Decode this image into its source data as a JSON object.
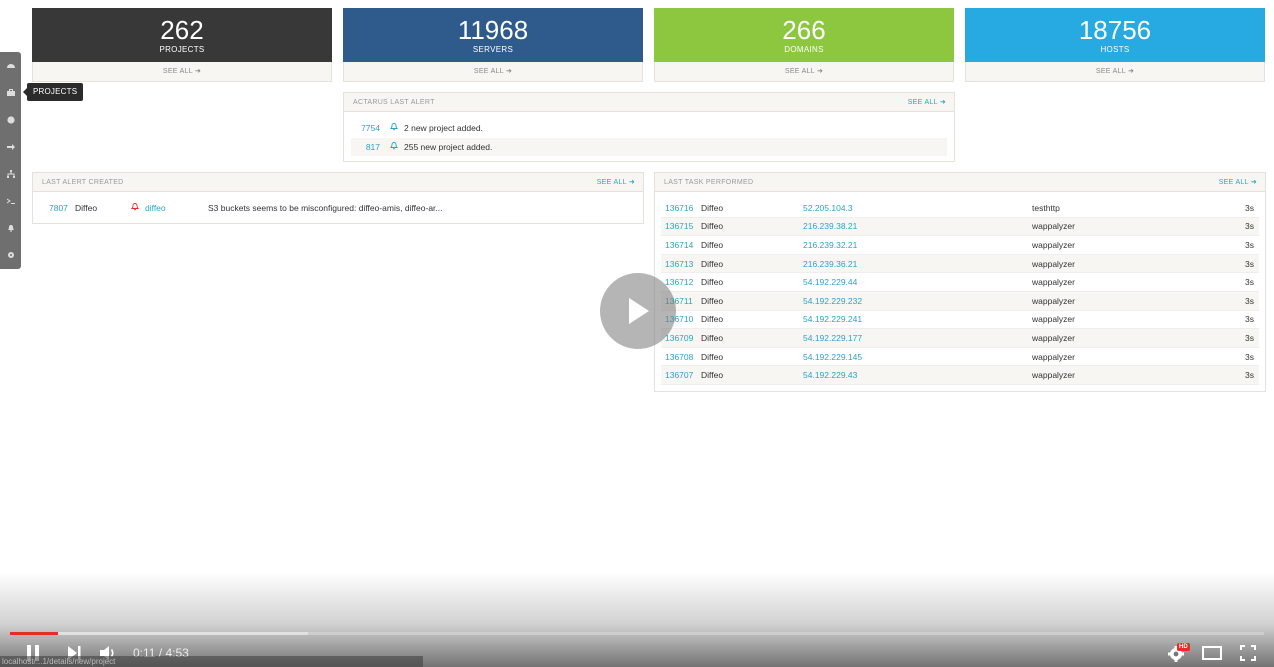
{
  "stats": [
    {
      "value": "262",
      "label": "PROJECTS",
      "see_all": "SEE ALL",
      "color": "#383838"
    },
    {
      "value": "11968",
      "label": "SERVERS",
      "see_all": "SEE ALL",
      "color": "#2f5a8c"
    },
    {
      "value": "266",
      "label": "DOMAINS",
      "see_all": "SEE ALL",
      "color": "#8dc63f"
    },
    {
      "value": "18756",
      "label": "HOSTS",
      "see_all": "SEE ALL",
      "color": "#27a9e1"
    }
  ],
  "sidebar": {
    "items": [
      "dashboard-icon",
      "projects-icon",
      "globe-icon",
      "arrow-icon",
      "sitemap-icon",
      "terminal-icon",
      "bell-icon",
      "gear-icon"
    ],
    "tooltip": "PROJECTS"
  },
  "actarus_alert": {
    "title": "ACTARUS LAST ALERT",
    "see_all": "SEE ALL",
    "rows": [
      {
        "id": "7754",
        "text": "2 new project added."
      },
      {
        "id": "817",
        "text": "255 new project added."
      }
    ]
  },
  "last_alert": {
    "title": "LAST ALERT CREATED",
    "see_all": "SEE ALL",
    "rows": [
      {
        "id": "7807",
        "project": "Diffeo",
        "tag": "diffeo",
        "text": "S3 buckets seems to be misconfigured: diffeo-amis, diffeo-ar..."
      }
    ]
  },
  "last_task": {
    "title": "LAST TASK PERFORMED",
    "see_all": "SEE ALL",
    "rows": [
      {
        "id": "136716",
        "project": "Diffeo",
        "ip": "52.205.104.3",
        "task": "testhttp",
        "dur": "3s"
      },
      {
        "id": "136715",
        "project": "Diffeo",
        "ip": "216.239.38.21",
        "task": "wappalyzer",
        "dur": "3s"
      },
      {
        "id": "136714",
        "project": "Diffeo",
        "ip": "216.239.32.21",
        "task": "wappalyzer",
        "dur": "3s"
      },
      {
        "id": "136713",
        "project": "Diffeo",
        "ip": "216.239.36.21",
        "task": "wappalyzer",
        "dur": "3s"
      },
      {
        "id": "136712",
        "project": "Diffeo",
        "ip": "54.192.229.44",
        "task": "wappalyzer",
        "dur": "3s"
      },
      {
        "id": "136711",
        "project": "Diffeo",
        "ip": "54.192.229.232",
        "task": "wappalyzer",
        "dur": "3s"
      },
      {
        "id": "136710",
        "project": "Diffeo",
        "ip": "54.192.229.241",
        "task": "wappalyzer",
        "dur": "3s"
      },
      {
        "id": "136709",
        "project": "Diffeo",
        "ip": "54.192.229.177",
        "task": "wappalyzer",
        "dur": "3s"
      },
      {
        "id": "136708",
        "project": "Diffeo",
        "ip": "54.192.229.145",
        "task": "wappalyzer",
        "dur": "3s"
      },
      {
        "id": "136707",
        "project": "Diffeo",
        "ip": "54.192.229.43",
        "task": "wappalyzer",
        "dur": "3s"
      }
    ]
  },
  "player": {
    "time": "0:11 / 4:53",
    "played_fraction": 0.038,
    "buffered_fraction": 0.238,
    "status_text": "localhost/...1/details/new/project",
    "hd_badge": "HD"
  }
}
